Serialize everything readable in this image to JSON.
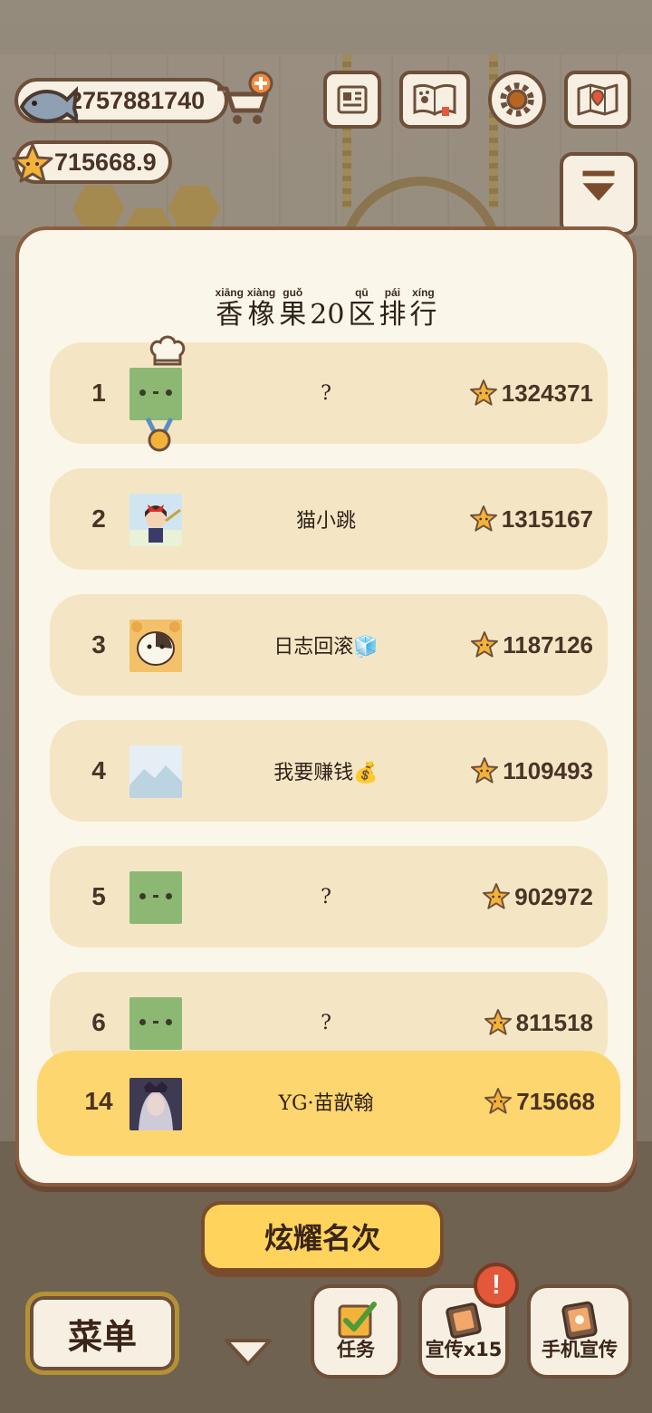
{
  "resources": {
    "fish": "2757881740",
    "stars": "715668.9"
  },
  "title": {
    "chars": [
      {
        "py": "xiāng",
        "hz": "香"
      },
      {
        "py": "xiàng",
        "hz": "橡"
      },
      {
        "py": "guǒ",
        "hz": "果"
      },
      {
        "py": "",
        "hz": "20"
      },
      {
        "py": "qū",
        "hz": "区"
      },
      {
        "py": "pái",
        "hz": "排"
      },
      {
        "py": "xíng",
        "hz": "行"
      }
    ]
  },
  "ranking": [
    {
      "rank": "1",
      "name": "?",
      "score": "1324371"
    },
    {
      "rank": "2",
      "name": "猫小跳",
      "score": "1315167"
    },
    {
      "rank": "3",
      "name": "日志回滚🧊",
      "score": "1187126"
    },
    {
      "rank": "4",
      "name": "我要赚钱💰",
      "score": "1109493"
    },
    {
      "rank": "5",
      "name": "?",
      "score": "902972"
    },
    {
      "rank": "6",
      "name": "?",
      "score": "811518"
    }
  ],
  "me": {
    "rank": "14",
    "name": "YG·苗歆翰",
    "score": "715668"
  },
  "buttons": {
    "show_rank": "炫耀名次",
    "menu": "菜单",
    "tasks": "任务",
    "promote": "宣传x15",
    "phone_promote": "手机宣传",
    "alert": "!"
  },
  "colors": {
    "panel_bg": "#fbf6ea",
    "row_bg": "#f4e6c4",
    "me_row_bg": "#fdd66f",
    "accent_yellow": "#ffd35c",
    "border_brown": "#6e4f3a"
  }
}
